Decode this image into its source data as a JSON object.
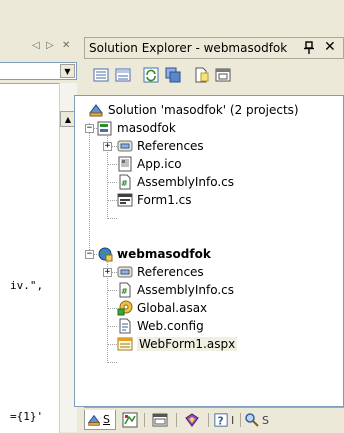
{
  "editor": {
    "tab_prev_glyph": "◁",
    "tab_next_glyph": "▷",
    "tab_close_glyph": "✕",
    "combo_arrow_glyph": "▼",
    "scroll_up_glyph": "▲",
    "code_fragments": [
      "iv.\",",
      "={1}'"
    ]
  },
  "solution_explorer": {
    "title": "Solution Explorer - webmasodfok",
    "pin_glyph": "ᵽ",
    "close_glyph": "✕",
    "toolbar_icons": [
      "properties-icon",
      "show-all-files-icon",
      "refresh-icon",
      "copy-project-icon",
      "view-code-icon",
      "view-designer-icon"
    ],
    "tree": {
      "solution_label": "Solution 'masodfok' (2 projects)",
      "project1": {
        "label": "masodfok",
        "items": [
          "References",
          "App.ico",
          "AssemblyInfo.cs",
          "Form1.cs"
        ]
      },
      "project2": {
        "label": "webmasodfok",
        "items": [
          "References",
          "AssemblyInfo.cs",
          "Global.asax",
          "Web.config",
          "WebForm1.aspx"
        ]
      },
      "selected_item": "WebForm1.aspx"
    },
    "bottom_tabs": {
      "solution_tab_letter": "S",
      "index_tab_letter": "I",
      "search_tab_letter": "S"
    }
  }
}
